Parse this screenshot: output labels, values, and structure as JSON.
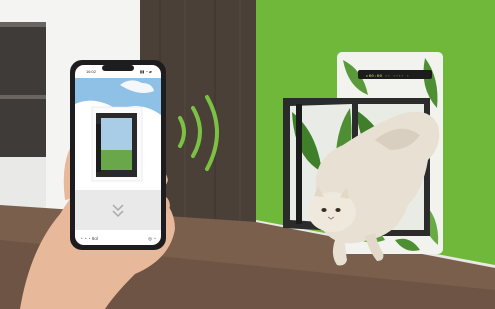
{
  "scene": {
    "colors": {
      "wall_green": "#6fb83a",
      "wood_wall": "#4a4038",
      "floor": "#7a5f4c",
      "cat_fur": "#e8e0d2",
      "door_frame": "#2b2b2b",
      "wifi_waves": "#7cc242"
    },
    "phone": {
      "status_left": "16:02",
      "status_right": "▮▮ ◔ ▰",
      "bottom_left": "◔ ◔ ◔ 8ol",
      "bottom_right": "◎ ◔"
    },
    "door_panel": {
      "display_text": "▸00:00 ◦◦ ◦◦◦◦ ◦"
    }
  }
}
